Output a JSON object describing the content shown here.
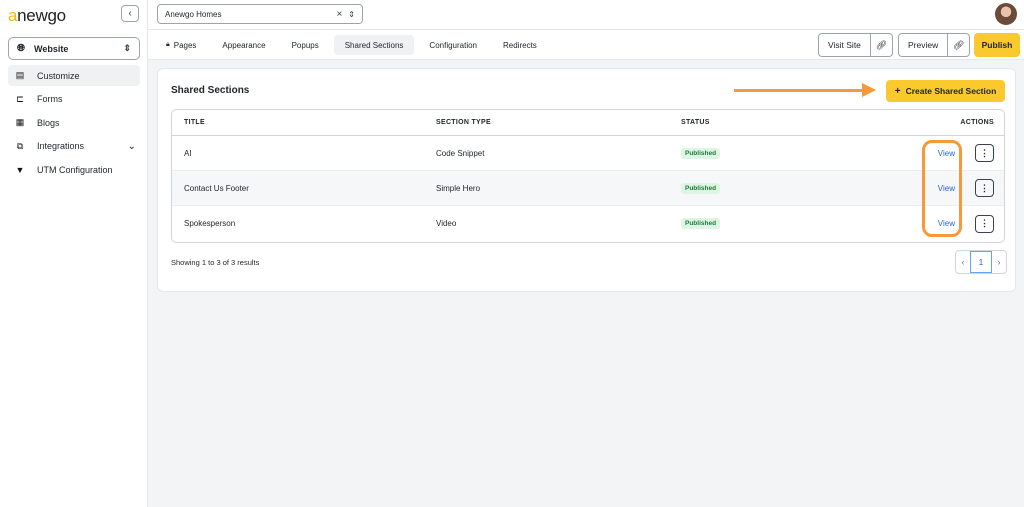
{
  "app": {
    "logo": "anewgo"
  },
  "sidebar": {
    "site_select": "Website",
    "items": [
      {
        "label": "Customize",
        "icon": "customize-icon",
        "active": true
      },
      {
        "label": "Forms",
        "icon": "forms-icon"
      },
      {
        "label": "Blogs",
        "icon": "blogs-icon"
      },
      {
        "label": "Integrations",
        "icon": "integrations-icon",
        "expandable": true
      },
      {
        "label": "UTM Configuration",
        "icon": "filter-icon"
      }
    ]
  },
  "topbar": {
    "project": "Anewgo Homes"
  },
  "tabs": [
    {
      "label": "Pages",
      "locked": true
    },
    {
      "label": "Appearance"
    },
    {
      "label": "Popups"
    },
    {
      "label": "Shared Sections",
      "active": true
    },
    {
      "label": "Configuration"
    },
    {
      "label": "Redirects"
    }
  ],
  "actions": {
    "visit_site": "Visit Site",
    "preview": "Preview",
    "publish": "Publish"
  },
  "card": {
    "title": "Shared Sections",
    "create_label": "Create Shared Section",
    "columns": {
      "title": "TITLE",
      "section_type": "SECTION TYPE",
      "status": "STATUS",
      "actions": "ACTIONS"
    },
    "rows": [
      {
        "title": "AI",
        "section_type": "Code Snippet",
        "status": "Published",
        "action": "View"
      },
      {
        "title": "Contact Us Footer",
        "section_type": "Simple Hero",
        "status": "Published",
        "action": "View"
      },
      {
        "title": "Spokesperson",
        "section_type": "Video",
        "status": "Published",
        "action": "View"
      }
    ],
    "results": "Showing 1 to 3 of 3 results",
    "page": "1"
  },
  "colors": {
    "accent": "#f9c92e",
    "annotation": "#f7993a",
    "link": "#2563eb",
    "badge_bg": "#dff5e4",
    "badge_text": "#1b7a3a"
  }
}
